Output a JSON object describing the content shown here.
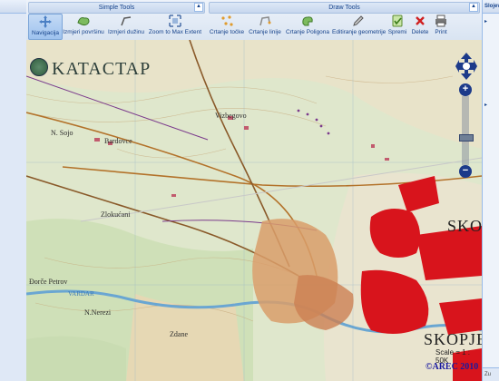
{
  "toolbar": {
    "simple_title": "Simple Tools",
    "draw_title": "Draw Tools",
    "tools": {
      "navigation": "Navigacija",
      "measure_area": "Izmjeri površinu",
      "measure_length": "Izmjeri dužinu",
      "zoom_max": "Zoom to Max Extent",
      "draw_point": "Crtanje točke",
      "draw_line": "Crtanje linije",
      "draw_polygon": "Crtanje Poligona",
      "edit_geometry": "Editiranje geometrije",
      "save": "Spremi",
      "delete": "Delete",
      "print": "Print"
    },
    "collapse_glyph": "▲"
  },
  "map": {
    "title": "KATACTAP",
    "places": {
      "vizbegovo": "Vizbegovo",
      "bardovce": "Bardovce",
      "sojo": "N. Sojo",
      "zlokucani": "Zlokućani",
      "dorcepetrov": "Đorče Petrov",
      "nerezi": "N.Nerezi",
      "zdane": "Zdane",
      "vardar": "VARDAR",
      "skopje_right": "SKOF",
      "skopje_city": "SKOPJE"
    },
    "scale": "Scale = 1 : 50K",
    "copyright": "©AREC 2010"
  },
  "right_panel": {
    "header": "Slojevi",
    "footer": "Zu"
  },
  "colors": {
    "accent": "#15428b",
    "urban": "#d8141c"
  }
}
